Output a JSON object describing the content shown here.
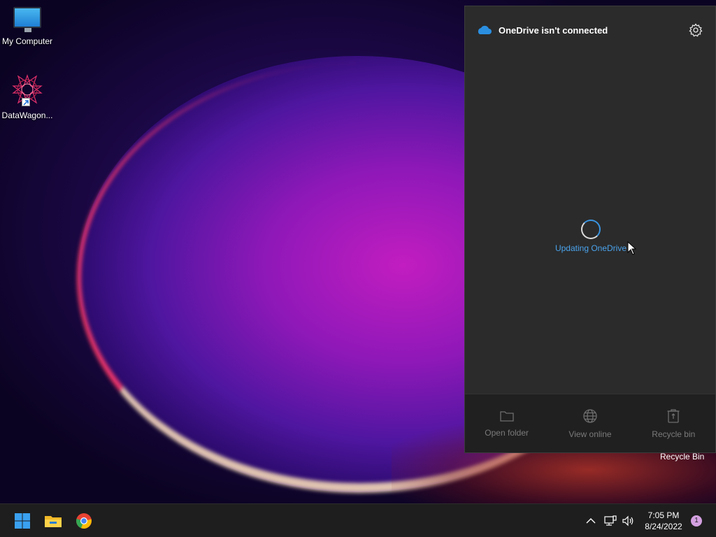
{
  "desktop": {
    "icons": [
      {
        "label": "My Computer"
      },
      {
        "label": "DataWagon..."
      }
    ]
  },
  "onedrive": {
    "title": "OneDrive isn't connected",
    "status": "Updating OneDrive",
    "footer": {
      "open_folder": "Open folder",
      "view_online": "View online",
      "recycle_bin": "Recycle bin"
    }
  },
  "tooltip": "Recycle Bin",
  "taskbar": {
    "time": "7:05 PM",
    "date": "8/24/2022",
    "notification_count": "1"
  },
  "colors": {
    "accent": "#4aa3ec",
    "flyout_bg": "#2b2b2b",
    "taskbar_bg": "#1e1e1e"
  }
}
